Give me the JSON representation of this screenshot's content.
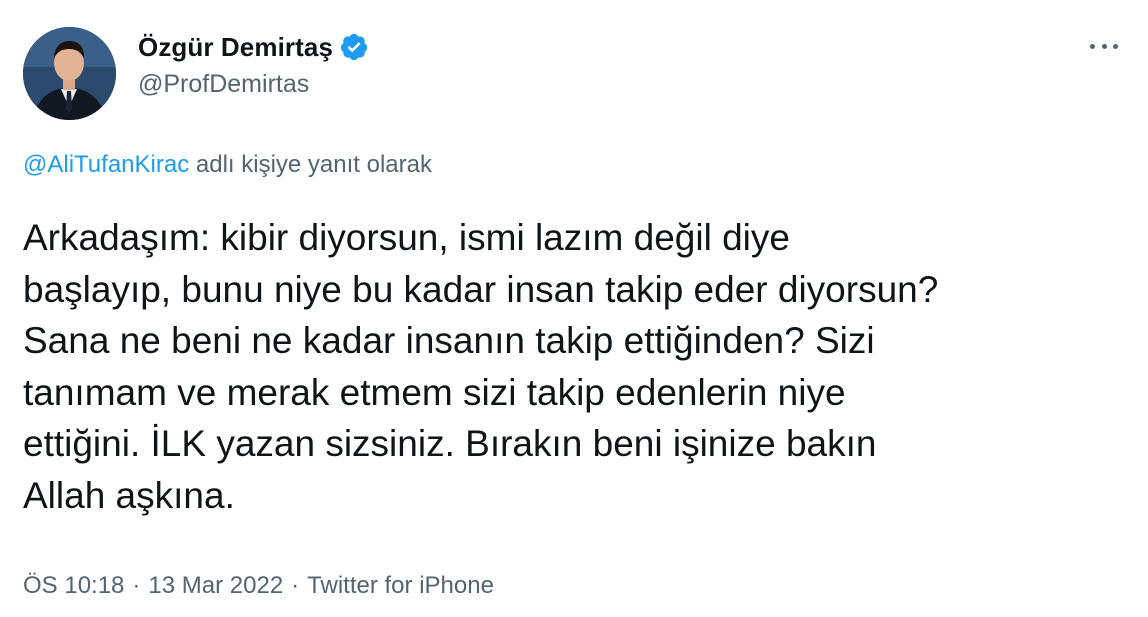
{
  "author": {
    "display_name": "Özgür Demirtaş",
    "handle": "@ProfDemirtas",
    "verified": true
  },
  "reply_context": {
    "replying_to": "@AliTufanKirac",
    "suffix": " adlı kişiye yanıt olarak"
  },
  "tweet": {
    "lines": [
      "Arkadaşım: kibir diyorsun, ismi lazım değil diye",
      "başlayıp, bunu niye bu kadar insan takip eder diyorsun?",
      "Sana ne beni ne kadar insanın takip ettiğinden? Sizi",
      "tanımam ve merak etmem sizi takip edenlerin niye",
      "ettiğini. İLK yazan sizsiniz. Bırakın beni işinize bakın",
      "Allah aşkına."
    ]
  },
  "meta": {
    "time": "ÖS 10:18",
    "separator": "·",
    "date": "13 Mar 2022",
    "source": "Twitter for iPhone"
  },
  "icons": {
    "verified": "verified-badge-icon",
    "more": "more-options-icon"
  },
  "colors": {
    "accent": "#1d9bf0",
    "secondary_text": "#536471",
    "primary_text": "#0f1419"
  }
}
